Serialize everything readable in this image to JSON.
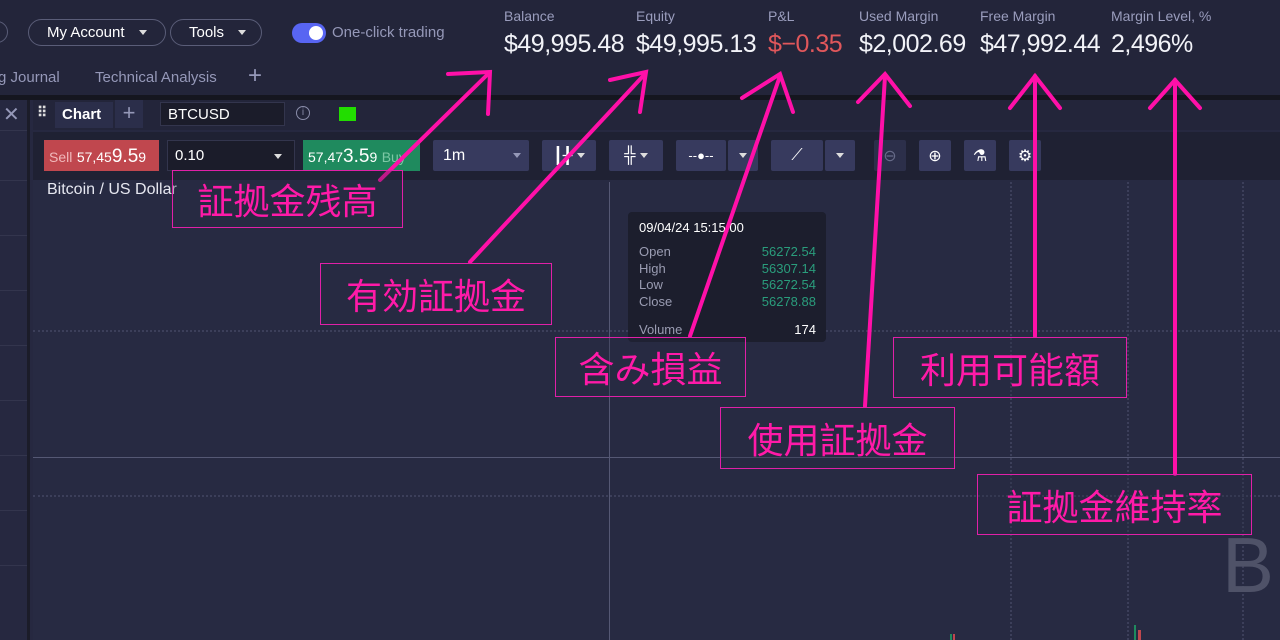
{
  "topbar": {
    "my_account": "My Account",
    "tools": "Tools",
    "one_click_trading": "One-click trading",
    "one_click_enabled": true,
    "tabs": [
      "g Journal",
      "Technical Analysis"
    ],
    "add_tab": "+"
  },
  "stats": [
    {
      "label": "Balance",
      "value": "$49,995.48"
    },
    {
      "label": "Equity",
      "value": "$49,995.13"
    },
    {
      "label": "P&L",
      "value": "$−0.35",
      "color": "#e0575b"
    },
    {
      "label": "Used Margin",
      "value": "$2,002.69"
    },
    {
      "label": "Free Margin",
      "value": "$47,992.44"
    },
    {
      "label": "Margin Level, %",
      "value": "2,496%"
    }
  ],
  "panel": {
    "tab": "Chart",
    "symbol": "BTCUSD",
    "status_color": "#22dd00"
  },
  "trade": {
    "sell_label": "Sell",
    "sell_price_small": "57,45",
    "sell_price_big": "9.5",
    "sell_price_tail": "9",
    "quantity": "0.10",
    "buy_price_small": "57,47",
    "buy_price_big": "3.5",
    "buy_price_tail": "9",
    "buy_label": "Buy",
    "timeframe": "1m"
  },
  "chart": {
    "instrument": "Bitcoin / US Dollar",
    "watermark": "B",
    "tooltip": {
      "datetime": "09/04/24 15:15:00",
      "rows": [
        {
          "k": "Open",
          "v": "56272.54"
        },
        {
          "k": "High",
          "v": "56307.14"
        },
        {
          "k": "Low",
          "v": "56272.54"
        },
        {
          "k": "Close",
          "v": "56278.88"
        }
      ],
      "volume_label": "Volume",
      "volume": "174"
    }
  },
  "annotations": [
    "証拠金残高",
    "有効証拠金",
    "含み損益",
    "使用証拠金",
    "利用可能額",
    "証拠金維持率"
  ],
  "colors": {
    "annotation": "#ff10a8",
    "sell": "#c0474e",
    "buy": "#1f8a5e",
    "accent": "#5865f2"
  }
}
